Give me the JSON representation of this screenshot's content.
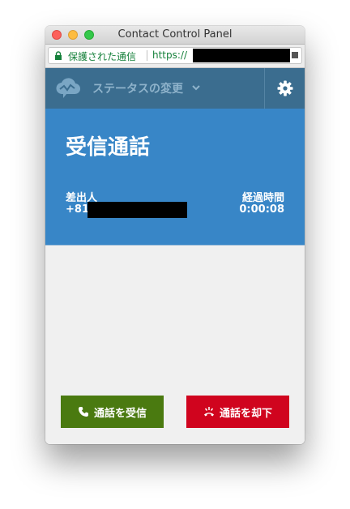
{
  "window": {
    "title": "Contact Control Panel"
  },
  "urlbar": {
    "secure_label": "保護された通信",
    "url_prefix": "https://"
  },
  "header": {
    "status_label": "ステータスの変更"
  },
  "call": {
    "title": "受信通話",
    "caller_label": "差出人",
    "caller_number_prefix": "+81",
    "elapsed_label": "経過時間",
    "elapsed_value": "0:00:08"
  },
  "actions": {
    "accept_label": "通話を受信",
    "decline_label": "通話を却下"
  },
  "colors": {
    "header": "#3b6d8f",
    "banner": "#3886c7",
    "accept": "#4a7a10",
    "decline": "#d0041e"
  },
  "icons": {
    "logo": "cloud-wave-icon",
    "status_toggle": "chevron-down-icon",
    "settings": "gear-icon",
    "accept": "phone-icon",
    "decline": "hangup-icon"
  }
}
